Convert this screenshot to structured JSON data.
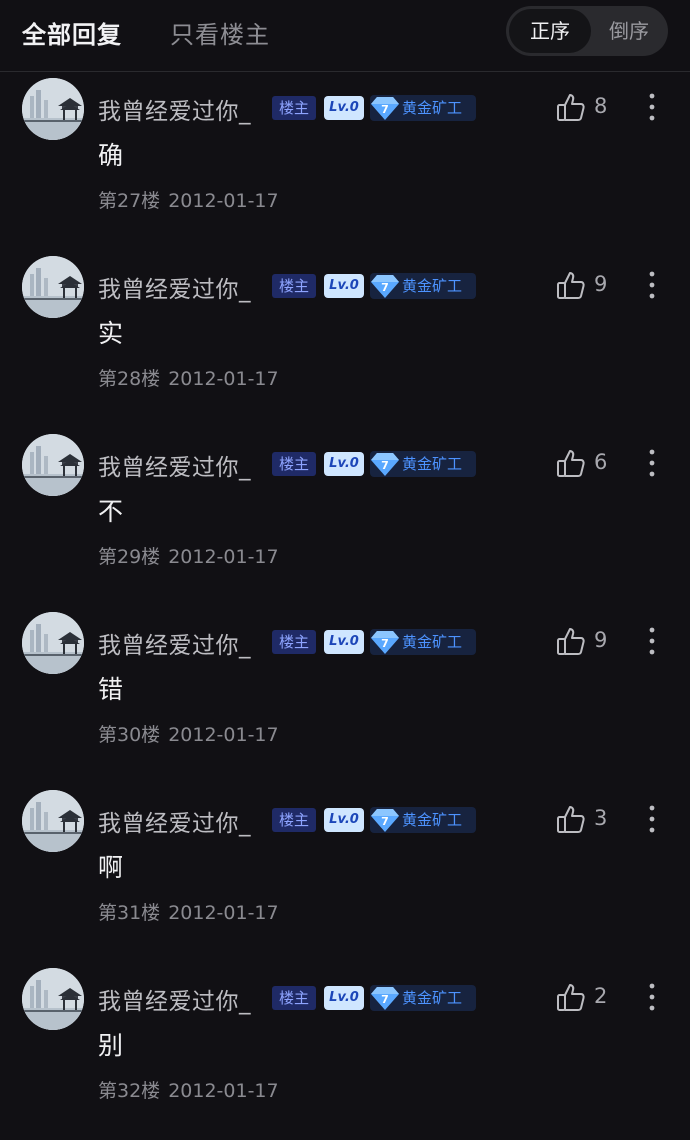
{
  "header": {
    "tab_all": "全部回复",
    "tab_owner_only": "只看楼主",
    "sort_asc": "正序",
    "sort_desc": "倒序"
  },
  "colors": {
    "background": "#111014",
    "owner_badge": "#1f2a66",
    "rank_text": "#4d93ff",
    "level_badge": "#cfe6ff"
  },
  "icons": [
    "thumbs-up-icon",
    "more-vertical-icon",
    "diamond-icon",
    "avatar-image"
  ],
  "posts": [
    {
      "username": "我曾经爱过你_",
      "owner_badge": "楼主",
      "level": "Lv.0",
      "rank_num": "7",
      "rank": "黄金矿工",
      "content": "确",
      "floor": "第27楼",
      "date": "2012-01-17",
      "likes": "8"
    },
    {
      "username": "我曾经爱过你_",
      "owner_badge": "楼主",
      "level": "Lv.0",
      "rank_num": "7",
      "rank": "黄金矿工",
      "content": "实",
      "floor": "第28楼",
      "date": "2012-01-17",
      "likes": "9"
    },
    {
      "username": "我曾经爱过你_",
      "owner_badge": "楼主",
      "level": "Lv.0",
      "rank_num": "7",
      "rank": "黄金矿工",
      "content": "不",
      "floor": "第29楼",
      "date": "2012-01-17",
      "likes": "6"
    },
    {
      "username": "我曾经爱过你_",
      "owner_badge": "楼主",
      "level": "Lv.0",
      "rank_num": "7",
      "rank": "黄金矿工",
      "content": "错",
      "floor": "第30楼",
      "date": "2012-01-17",
      "likes": "9"
    },
    {
      "username": "我曾经爱过你_",
      "owner_badge": "楼主",
      "level": "Lv.0",
      "rank_num": "7",
      "rank": "黄金矿工",
      "content": "啊",
      "floor": "第31楼",
      "date": "2012-01-17",
      "likes": "3"
    },
    {
      "username": "我曾经爱过你_",
      "owner_badge": "楼主",
      "level": "Lv.0",
      "rank_num": "7",
      "rank": "黄金矿工",
      "content": "别",
      "floor": "第32楼",
      "date": "2012-01-17",
      "likes": "2"
    }
  ]
}
